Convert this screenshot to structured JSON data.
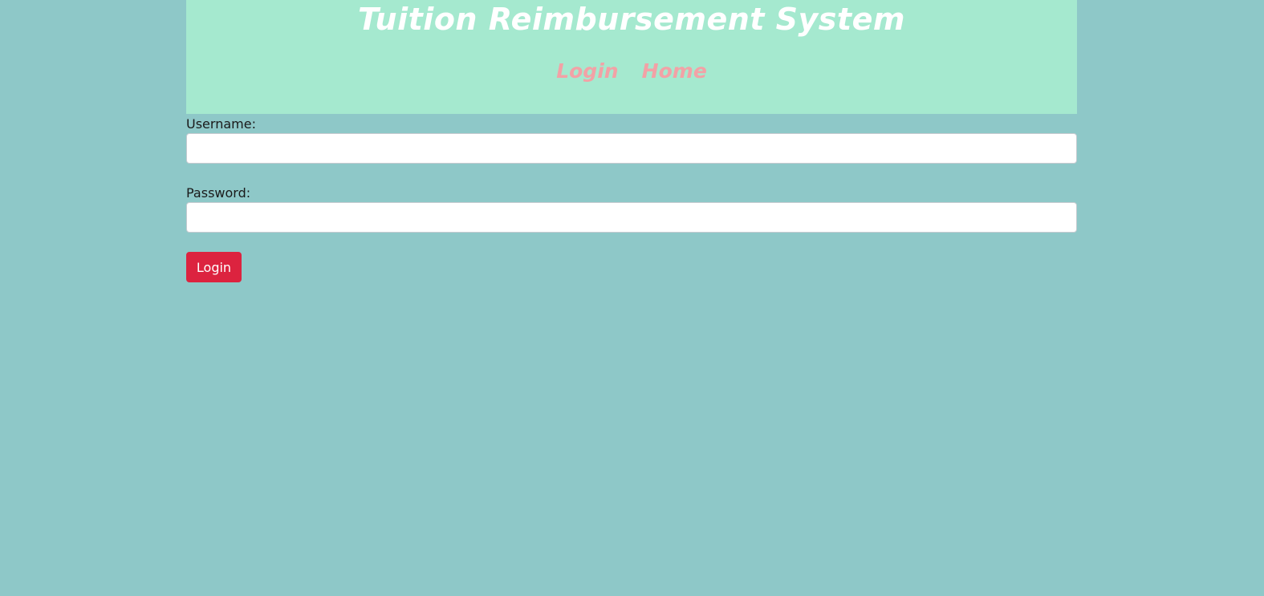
{
  "header": {
    "title": "Tuition Reimbursement System",
    "nav": [
      {
        "label": "Login"
      },
      {
        "label": "Home"
      }
    ]
  },
  "form": {
    "username_label": "Username:",
    "username_value": "",
    "password_label": "Password:",
    "password_value": "",
    "submit_label": "Login"
  },
  "colors": {
    "page_background": "#8ec8c8",
    "header_background": "#a5e9cf",
    "title_color": "#ffffff",
    "nav_link_color": "#f2a2a6",
    "button_color": "#dc233f"
  }
}
